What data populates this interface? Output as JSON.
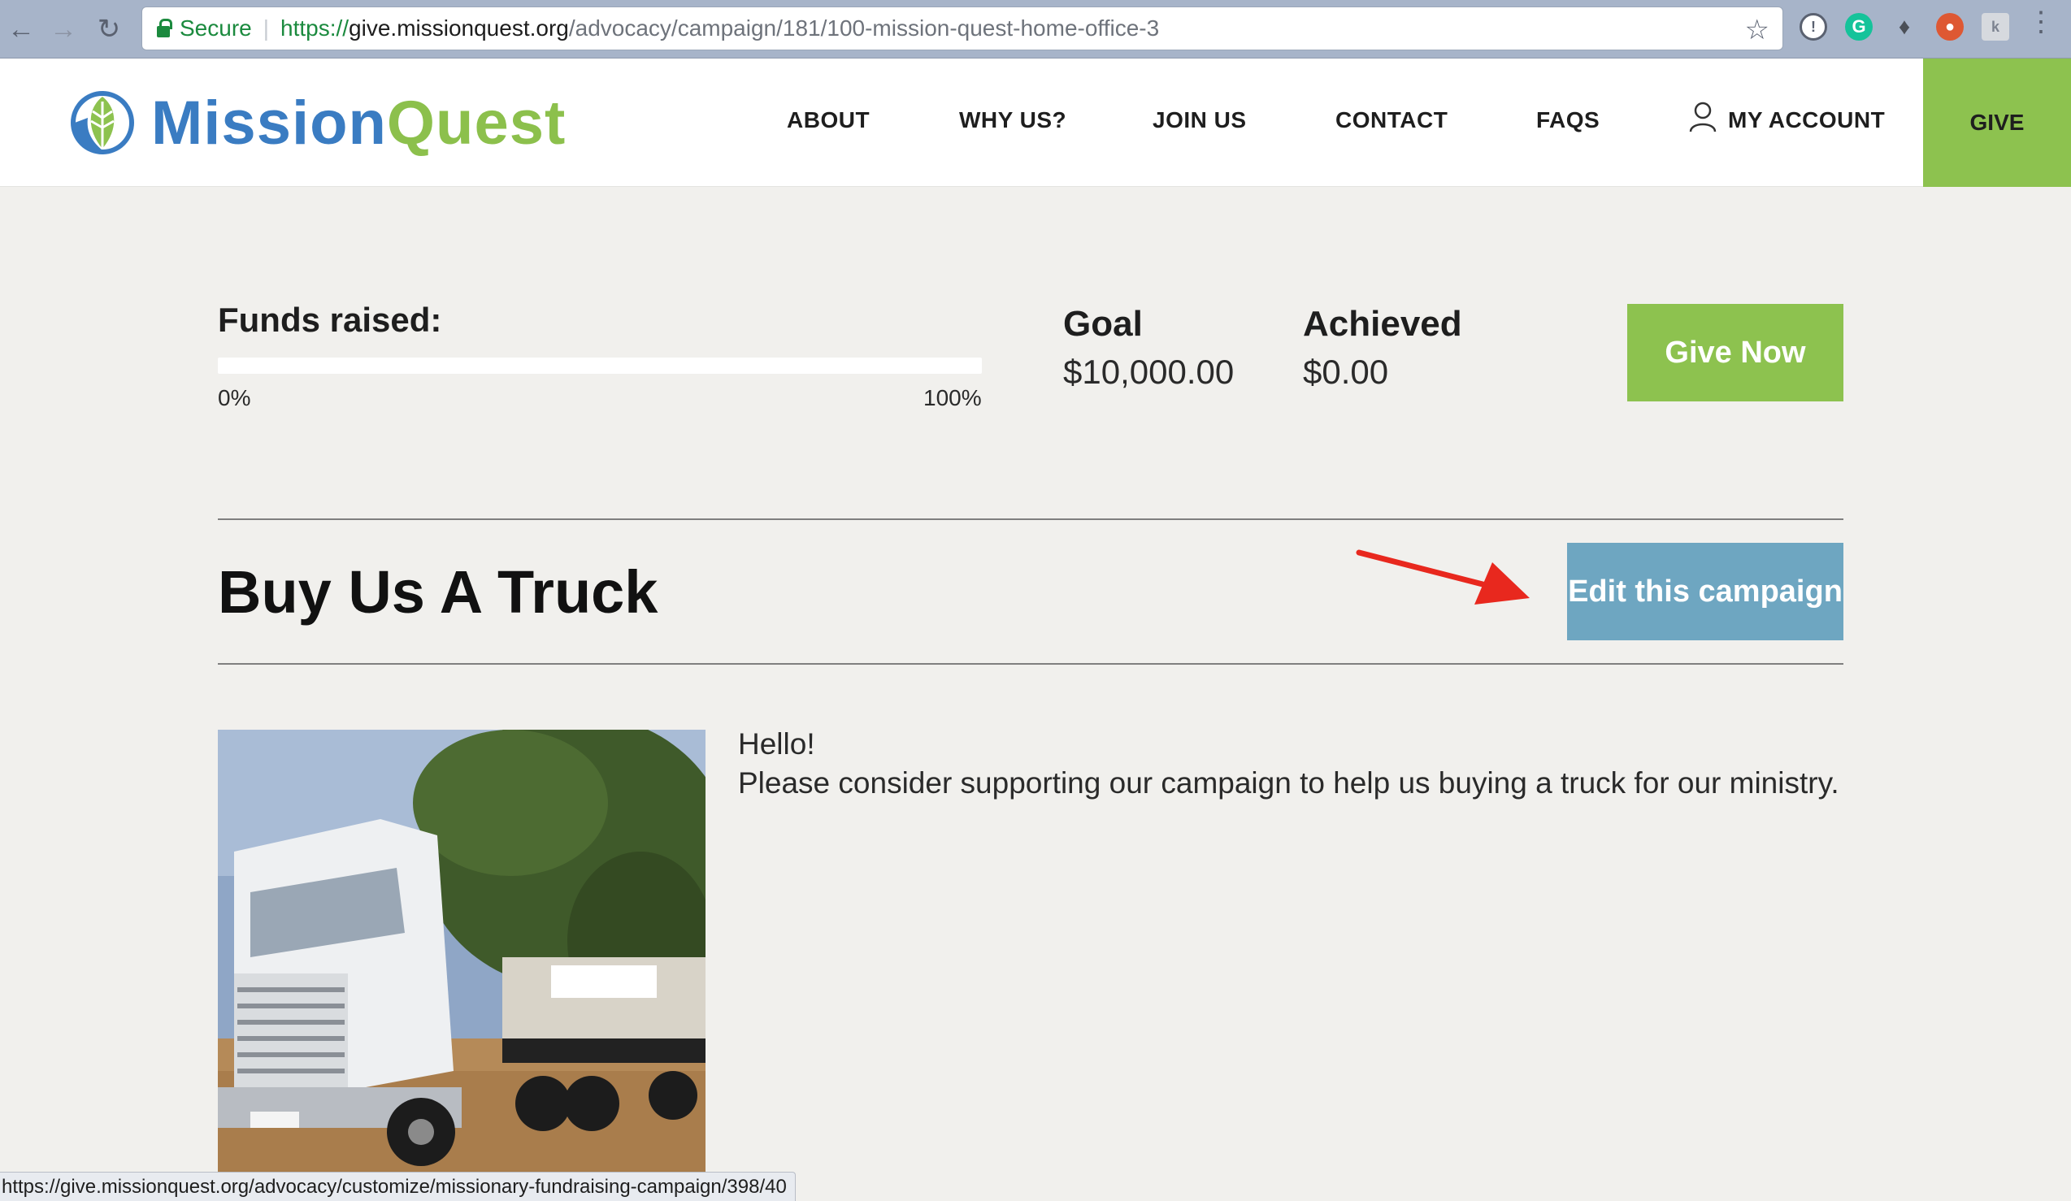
{
  "browser": {
    "secure_label": "Secure",
    "url_scheme": "https://",
    "url_host": "give.missionquest.org",
    "url_path": "/advocacy/campaign/181/100-mission-quest-home-office-3",
    "status_url": "https://give.missionquest.org/advocacy/customize/missionary-fundraising-campaign/398/40"
  },
  "site": {
    "logo_part1": "Mission",
    "logo_part2": "Quest",
    "nav": {
      "about": "ABOUT",
      "why_us": "WHY US?",
      "join_us": "JOIN US",
      "contact": "CONTACT",
      "faqs": "FAQS",
      "my_account": "MY ACCOUNT",
      "give": "GIVE"
    }
  },
  "funds": {
    "title": "Funds raised:",
    "progress_fraction": 0,
    "min_label": "0%",
    "max_label": "100%",
    "goal_label": "Goal",
    "goal_value": "$10,000.00",
    "achieved_label": "Achieved",
    "achieved_value": "$0.00",
    "give_now": "Give Now"
  },
  "campaign": {
    "title": "Buy Us A Truck",
    "edit_button": "Edit this campaign",
    "greeting": "Hello!",
    "description": "Please consider supporting our campaign to help us buying a truck for our ministry."
  },
  "colors": {
    "brand_blue": "#3a7cc2",
    "brand_green": "#8dc24f",
    "edit_blue": "#6ea6c1",
    "annotation_red": "#e8281e"
  }
}
